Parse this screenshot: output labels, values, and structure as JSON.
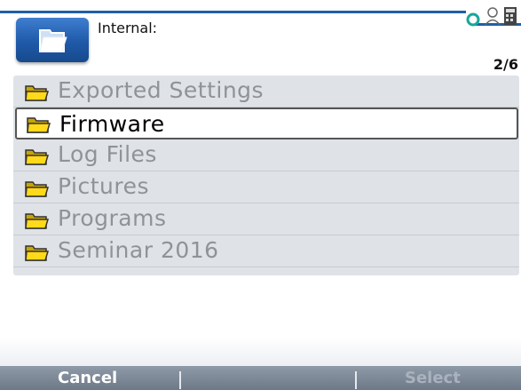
{
  "header": {
    "title": "Internal:",
    "page_indicator": "2/6",
    "accent_color": "#1e5fa8"
  },
  "folders": [
    {
      "label": "Exported Settings",
      "selected": false
    },
    {
      "label": "Firmware",
      "selected": true
    },
    {
      "label": "Log Files",
      "selected": false
    },
    {
      "label": "Pictures",
      "selected": false
    },
    {
      "label": "Programs",
      "selected": false
    },
    {
      "label": "Seminar 2016",
      "selected": false
    }
  ],
  "softkeys": {
    "left": "Cancel",
    "right": "Select",
    "right_enabled": false
  },
  "icons": {
    "app": "folder-app-icon",
    "item": "folder-icon",
    "status": [
      "loop-icon",
      "user-icon",
      "calculator-icon"
    ]
  }
}
